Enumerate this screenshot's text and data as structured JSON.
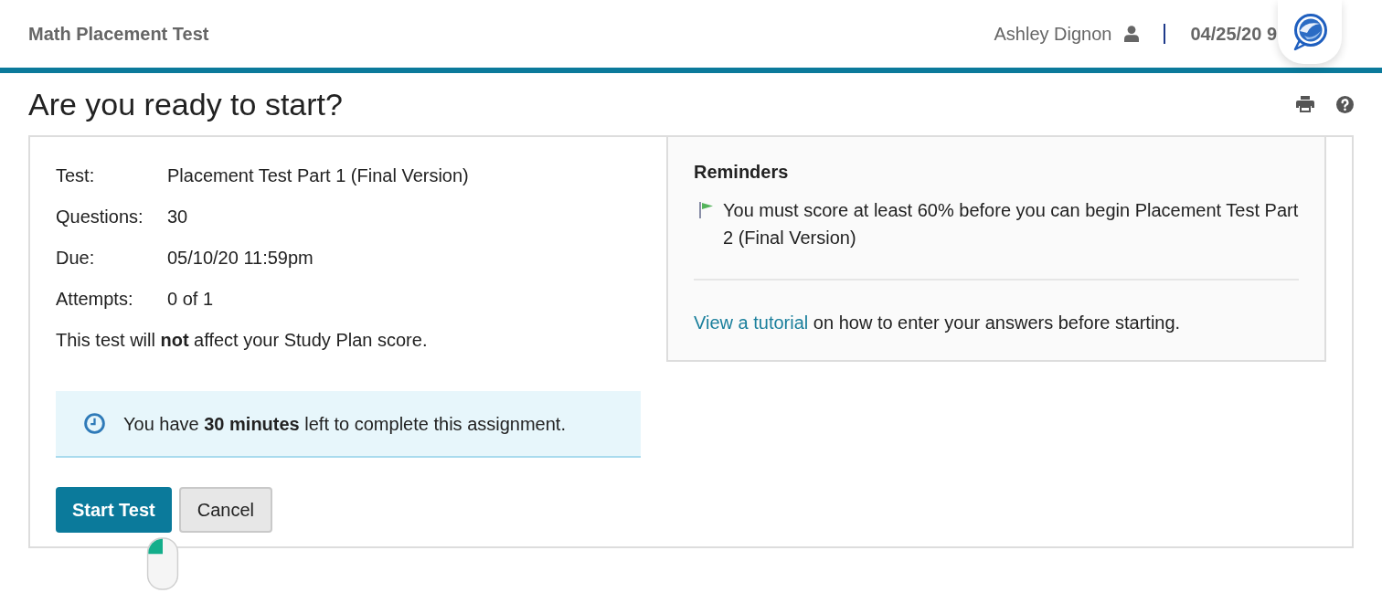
{
  "header": {
    "title": "Math Placement Test",
    "user_name": "Ashley Dignon",
    "date": "04/25/20 9"
  },
  "page": {
    "heading": "Are you ready to start?"
  },
  "details": [
    {
      "label": "Test:",
      "value": "Placement Test Part 1 (Final Version)"
    },
    {
      "label": "Questions:",
      "value": "30"
    },
    {
      "label": "Due:",
      "value": "05/10/20 11:59pm"
    },
    {
      "label": "Attempts:",
      "value": "0 of 1"
    }
  ],
  "note": "This test will **not** affect your Study Plan score.",
  "time_alert": {
    "text": "You have **30 minutes** left to complete this assignment."
  },
  "buttons": [
    {
      "label": "Start Test",
      "kind": "primary"
    },
    {
      "label": "Cancel",
      "kind": "secondary"
    }
  ],
  "reminders": {
    "title": "Reminders",
    "items": [
      {
        "text": "You must score at least 60% before you can begin Placement Test Part 2 (Final Version)"
      }
    ],
    "tutorial": {
      "link": "View a tutorial",
      "text": "on how to enter your answers before starting."
    }
  }
}
